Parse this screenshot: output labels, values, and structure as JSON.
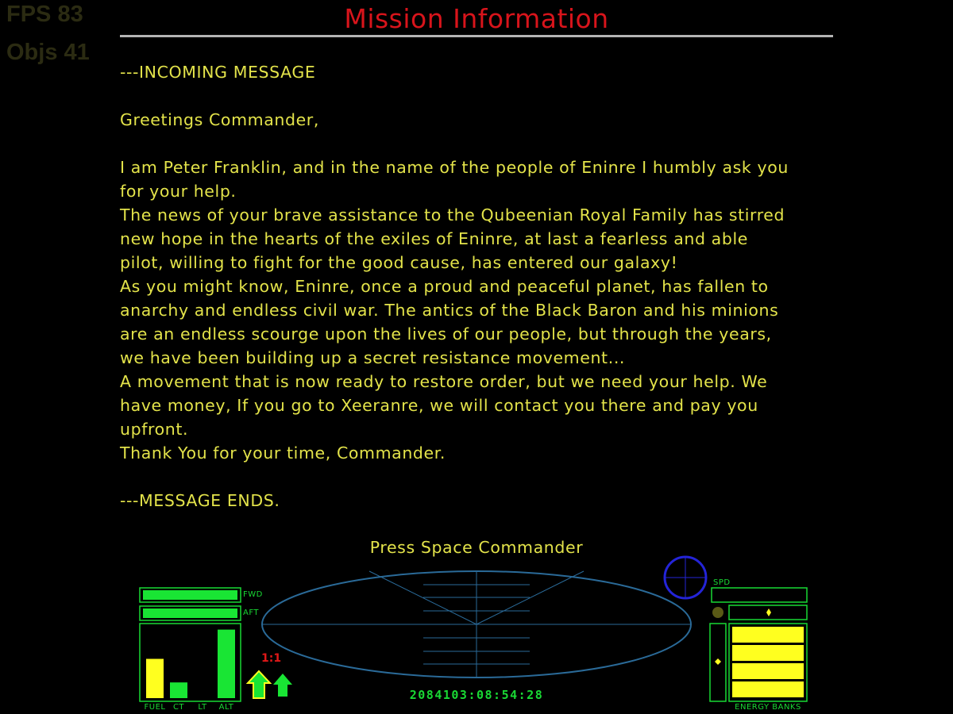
{
  "stats": {
    "fps": "FPS 83",
    "objs": "Objs 41"
  },
  "title": "Mission Information",
  "message": {
    "lines": [
      "---INCOMING MESSAGE",
      "",
      "Greetings Commander,",
      "",
      "I am Peter Franklin, and in the name of the people of Eninre I humbly ask you",
      "for your help.",
      "The news of your brave assistance to the Qubeenian Royal Family has stirred",
      "new hope in the hearts of the exiles of Eninre, at last a fearless and able",
      "pilot, willing to fight for the good cause, has entered our galaxy!",
      "As you might know, Eninre, once a proud and peaceful planet, has fallen to",
      "anarchy and endless civil war. The antics of the Black Baron and his minions",
      "are an endless scourge upon the lives of our people, but through the years,",
      "we have been building up a secret resistance movement...",
      "A movement that is now ready to restore order, but we need your help. We",
      "have money, If you go to Xeeranre, we will contact you there and pay you",
      "upfront.",
      "Thank You for your time, Commander.",
      "",
      "---MESSAGE ENDS."
    ]
  },
  "prompt": "Press Space Commander",
  "hud": {
    "shield_labels": {
      "fwd": "FWD",
      "aft": "AFT"
    },
    "shields": {
      "fwd": 1.0,
      "aft": 1.0
    },
    "gauges": [
      {
        "label": "FUEL",
        "level": 0.55,
        "color": "#ffff1f"
      },
      {
        "label": "CT",
        "level": 0.22,
        "color": "#19e534"
      },
      {
        "label": "LT",
        "level": 0.0,
        "color": "#19e534"
      },
      {
        "label": "ALT",
        "level": 0.96,
        "color": "#19e534"
      }
    ],
    "ratio": "1:1",
    "clock": "2084103:08:54:28",
    "speed_label": "SPD",
    "speed": 0.0,
    "energy_label": "ENERGY BANKS",
    "energy_banks": 4,
    "colors": {
      "hud_green": "#19d934",
      "yellow": "#ffff1f",
      "scanner": "#2a6a98",
      "compass": "#2424d8",
      "title_red": "#d8141b"
    },
    "icons": [
      "up-arrow-icon",
      "up-arrow-icon",
      "compass-icon",
      "diamond-icon"
    ]
  }
}
